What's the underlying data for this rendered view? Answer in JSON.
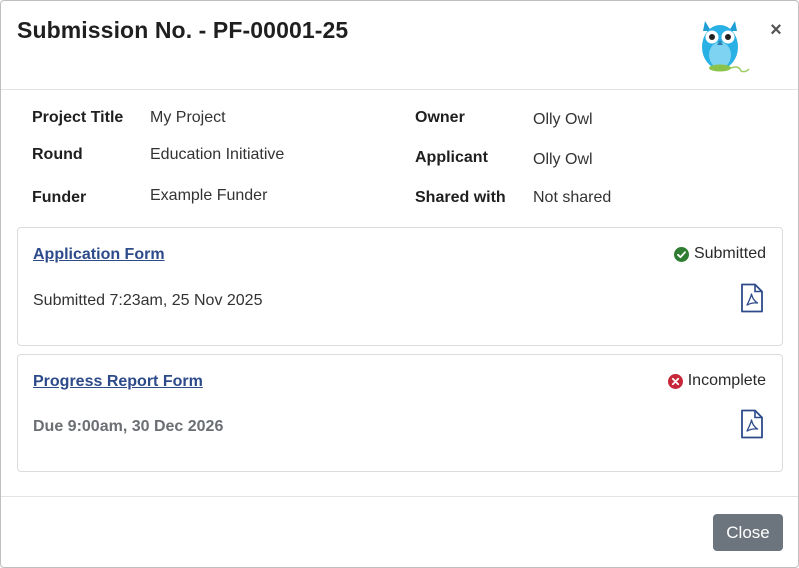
{
  "modal": {
    "title": "Submission No. - PF-00001-25",
    "close_icon": "×",
    "logo_icon": "owl-logo"
  },
  "details": {
    "project_title_label": "Project Title",
    "project_title_value": "My Project",
    "round_label": "Round",
    "round_value": "Education Initiative",
    "funder_label": "Funder",
    "funder_value": "Example Funder",
    "owner_label": "Owner",
    "owner_value": "Olly Owl",
    "applicant_label": "Applicant",
    "applicant_value": "Olly Owl",
    "shared_label": "Shared with",
    "shared_value": "Not shared"
  },
  "forms": [
    {
      "name": "Application Form",
      "status": "Submitted",
      "status_color": "#2e7d32",
      "status_icon": "check-circle-icon",
      "sub_text": "Submitted 7:23am, 25 Nov 2025",
      "pdf_icon": "pdf-file-icon"
    },
    {
      "name": "Progress Report Form",
      "status": "Incomplete",
      "status_color": "#c62839",
      "status_icon": "x-circle-icon",
      "sub_text": "Due 9:00am, 30 Dec 2026",
      "pdf_icon": "pdf-file-icon"
    }
  ],
  "footer": {
    "close_label": "Close"
  },
  "colors": {
    "link": "#2d4a8a",
    "button_secondary": "#6c757d"
  }
}
